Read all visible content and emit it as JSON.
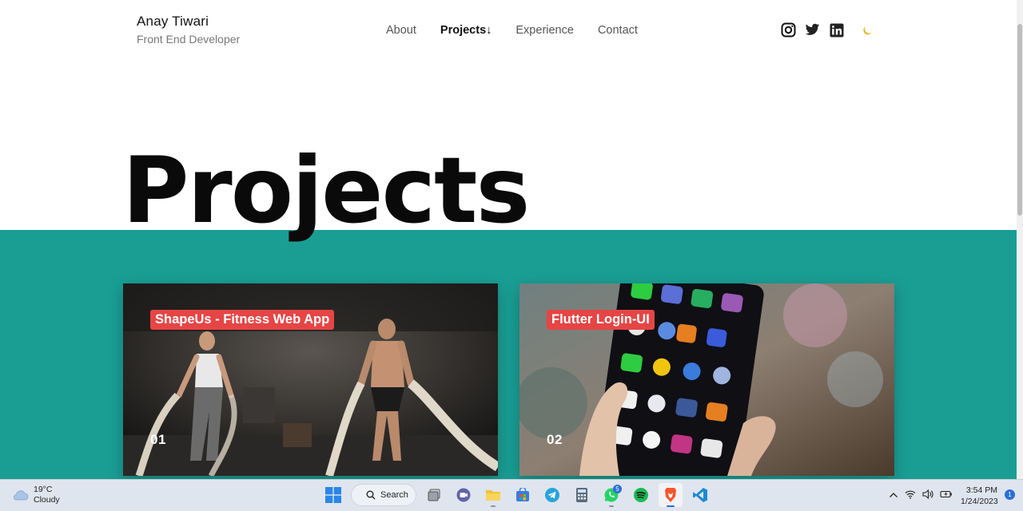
{
  "header": {
    "name": "Anay Tiwari",
    "role": "Front End Developer",
    "nav": [
      {
        "label": "About"
      },
      {
        "label": "Projects↓"
      },
      {
        "label": "Experience"
      },
      {
        "label": "Contact"
      }
    ],
    "socials": [
      "instagram-icon",
      "twitter-icon",
      "linkedin-icon"
    ],
    "theme_toggle_icon": "moon-icon"
  },
  "hero": {
    "title": "Projects"
  },
  "colors": {
    "accent_teal": "#1a9e94",
    "label_red": "#e64545",
    "moon_yellow": "#e3b21a"
  },
  "projects": [
    {
      "title": "ShapeUs - Fitness Web App",
      "number": "01",
      "image": "gym-battle-ropes-photo"
    },
    {
      "title": "Flutter Login-UI",
      "number": "02",
      "image": "smartphone-homescreen-photo"
    }
  ],
  "taskbar": {
    "weather": {
      "temp": "19°C",
      "condition": "Cloudy"
    },
    "search_label": "Search",
    "whatsapp_badge": "5",
    "time": "3:54 PM",
    "date": "1/24/2023",
    "notification_count": "1"
  }
}
